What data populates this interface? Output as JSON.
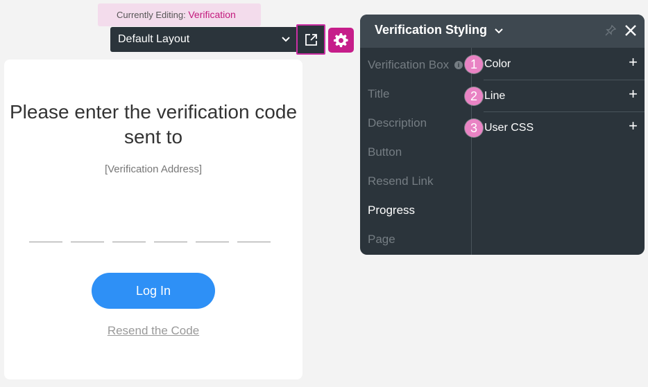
{
  "editing": {
    "label": "Currently Editing:",
    "value": "Verification"
  },
  "layout_select": {
    "value": "Default Layout"
  },
  "card": {
    "title": "Please enter the verification code sent to",
    "address": "[Verification Address]",
    "login_label": "Log In",
    "resend_label": "Resend the Code"
  },
  "panel": {
    "title": "Verification Styling",
    "nav_items": [
      {
        "label": "Verification Box"
      },
      {
        "label": "Title"
      },
      {
        "label": "Description"
      },
      {
        "label": "Button"
      },
      {
        "label": "Resend Link"
      },
      {
        "label": "Progress"
      },
      {
        "label": "Page"
      }
    ],
    "active_item": "Progress",
    "info_glyph": "i",
    "properties": [
      {
        "label": "Color",
        "step": "1"
      },
      {
        "label": "Line",
        "step": "2"
      },
      {
        "label": "User CSS",
        "step": "3"
      }
    ],
    "plus_glyph": "+"
  },
  "colors": {
    "accent": "#c61d8a",
    "login_button": "#2e90f6",
    "panel_bg": "#2b343b",
    "step_badge": "#e983c4"
  }
}
